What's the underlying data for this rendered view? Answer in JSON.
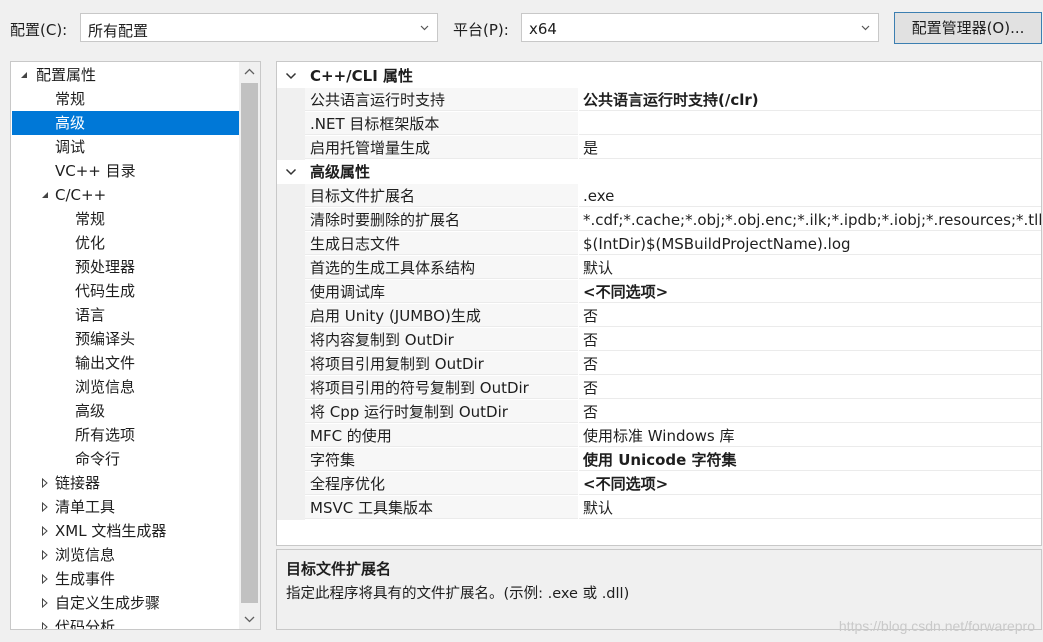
{
  "toolbar": {
    "config_label": "配置(C):",
    "config_value": "所有配置",
    "platform_label": "平台(P):",
    "platform_value": "x64",
    "manager_button": "配置管理器(O)..."
  },
  "tree": {
    "items": [
      {
        "label": "配置属性",
        "level": 0,
        "arrow": "expanded"
      },
      {
        "label": "常规",
        "level": 1,
        "arrow": "none"
      },
      {
        "label": "高级",
        "level": 1,
        "arrow": "none",
        "selected": true
      },
      {
        "label": "调试",
        "level": 1,
        "arrow": "none"
      },
      {
        "label": "VC++ 目录",
        "level": 1,
        "arrow": "none"
      },
      {
        "label": "C/C++",
        "level": 1,
        "arrow": "expanded"
      },
      {
        "label": "常规",
        "level": 2,
        "arrow": "none"
      },
      {
        "label": "优化",
        "level": 2,
        "arrow": "none"
      },
      {
        "label": "预处理器",
        "level": 2,
        "arrow": "none"
      },
      {
        "label": "代码生成",
        "level": 2,
        "arrow": "none"
      },
      {
        "label": "语言",
        "level": 2,
        "arrow": "none"
      },
      {
        "label": "预编译头",
        "level": 2,
        "arrow": "none"
      },
      {
        "label": "输出文件",
        "level": 2,
        "arrow": "none"
      },
      {
        "label": "浏览信息",
        "level": 2,
        "arrow": "none"
      },
      {
        "label": "高级",
        "level": 2,
        "arrow": "none"
      },
      {
        "label": "所有选项",
        "level": 2,
        "arrow": "none"
      },
      {
        "label": "命令行",
        "level": 2,
        "arrow": "none"
      },
      {
        "label": "链接器",
        "level": 1,
        "arrow": "collapsed"
      },
      {
        "label": "清单工具",
        "level": 1,
        "arrow": "collapsed"
      },
      {
        "label": "XML 文档生成器",
        "level": 1,
        "arrow": "collapsed"
      },
      {
        "label": "浏览信息",
        "level": 1,
        "arrow": "collapsed"
      },
      {
        "label": "生成事件",
        "level": 1,
        "arrow": "collapsed"
      },
      {
        "label": "自定义生成步骤",
        "level": 1,
        "arrow": "collapsed"
      },
      {
        "label": "代码分析",
        "level": 1,
        "arrow": "collapsed"
      }
    ]
  },
  "grid": {
    "sections": [
      {
        "title": "C++/CLI 属性",
        "rows": [
          {
            "name": "公共语言运行时支持",
            "value": "公共语言运行时支持(/clr)",
            "bold": true
          },
          {
            "name": ".NET 目标框架版本",
            "value": "",
            "bold": false
          },
          {
            "name": "启用托管增量生成",
            "value": "是",
            "bold": false
          }
        ]
      },
      {
        "title": "高级属性",
        "rows": [
          {
            "name": "目标文件扩展名",
            "value": ".exe",
            "bold": false
          },
          {
            "name": "清除时要删除的扩展名",
            "value": "*.cdf;*.cache;*.obj;*.obj.enc;*.ilk;*.ipdb;*.iobj;*.resources;*.tlb;*",
            "bold": false
          },
          {
            "name": "生成日志文件",
            "value": "$(IntDir)$(MSBuildProjectName).log",
            "bold": false
          },
          {
            "name": "首选的生成工具体系结构",
            "value": "默认",
            "bold": false
          },
          {
            "name": "使用调试库",
            "value": "<不同选项>",
            "bold": true
          },
          {
            "name": "启用 Unity (JUMBO)生成",
            "value": "否",
            "bold": false
          },
          {
            "name": "将内容复制到 OutDir",
            "value": "否",
            "bold": false
          },
          {
            "name": "将项目引用复制到 OutDir",
            "value": "否",
            "bold": false
          },
          {
            "name": "将项目引用的符号复制到 OutDir",
            "value": "否",
            "bold": false
          },
          {
            "name": "将 Cpp 运行时复制到 OutDir",
            "value": "否",
            "bold": false
          },
          {
            "name": "MFC 的使用",
            "value": "使用标准 Windows 库",
            "bold": false
          },
          {
            "name": "字符集",
            "value": "使用 Unicode 字符集",
            "bold": true
          },
          {
            "name": "全程序优化",
            "value": "<不同选项>",
            "bold": true
          },
          {
            "name": "MSVC 工具集版本",
            "value": "默认",
            "bold": false
          }
        ]
      }
    ]
  },
  "description": {
    "title": "目标文件扩展名",
    "text": "指定此程序将具有的文件扩展名。(示例: .exe 或 .dll)"
  },
  "watermark": "https://blog.csdn.net/forwarepro",
  "colors": {
    "selection": "#0078d7",
    "button_border": "#3c7fb1"
  }
}
